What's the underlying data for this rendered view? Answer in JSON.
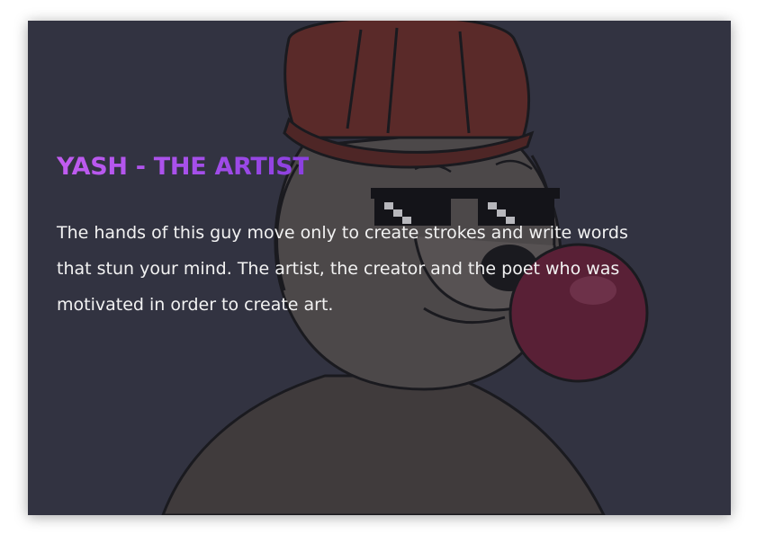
{
  "hero": {
    "title": "YASH - THE ARTIST",
    "description": "The hands of this guy move only to create strokes and write words that stun your mind. The artist, the creator and the poet who was motivated in order to create art."
  },
  "colors": {
    "card_background": "#353744",
    "title_gradient_start": "#c15cf0",
    "title_gradient_end": "#8b3fe0",
    "text": "#f2f2f2",
    "cap": "#6f2a22",
    "bubble": "#6e1c34"
  },
  "illustration": {
    "subject": "dog-with-cap-pixel-sunglasses-and-bubblegum-illustration"
  }
}
